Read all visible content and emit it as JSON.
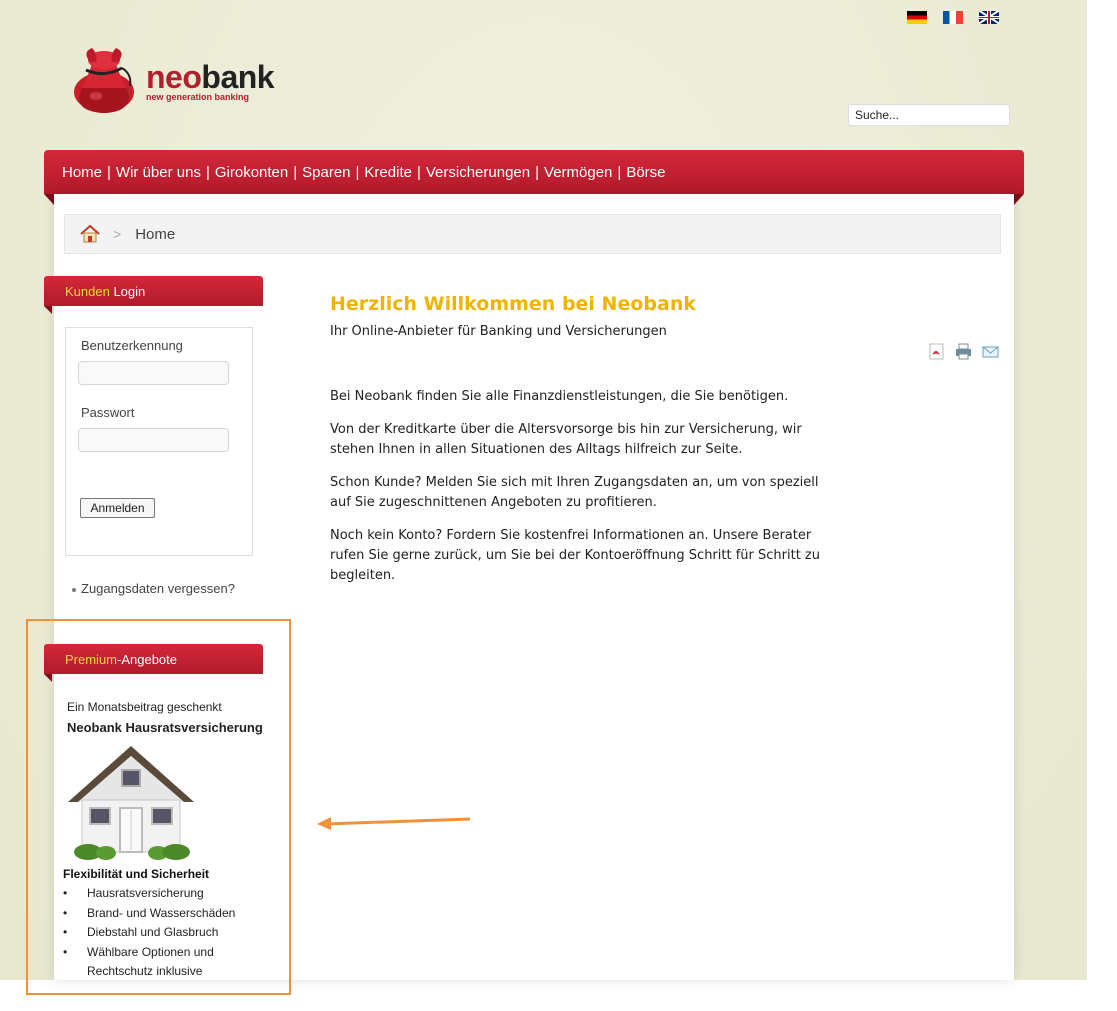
{
  "header": {
    "flags": [
      {
        "name": "german-flag-icon"
      },
      {
        "name": "french-flag-icon"
      },
      {
        "name": "english-flag-icon"
      }
    ],
    "logo": {
      "part1": "neo",
      "part2": "bank",
      "tagline": "new generation banking"
    },
    "search": {
      "value": "Suche..."
    }
  },
  "nav": {
    "items": [
      "Home",
      "Wir über uns",
      "Girokonten",
      "Sparen",
      "Kredite",
      "Versicherungen",
      "Vermögen",
      "Börse"
    ],
    "separator": "|"
  },
  "breadcrumb": {
    "separator": ">",
    "current": "Home"
  },
  "login": {
    "title_highlight": "Kunden",
    "title_rest": " Login",
    "username_label": "Benutzerkennung",
    "password_label": "Passwort",
    "submit_label": "Anmelden",
    "forgot_label": "Zugangsdaten vergessen?"
  },
  "premium": {
    "title_highlight": "Premium",
    "title_rest": "-Angebote",
    "subtitle": "Ein Monatsbeitrag geschenkt",
    "product": "Neobank Hausratsversicherung",
    "features_title": "Flexibilität und Sicherheit",
    "bullet": "•",
    "features": [
      "Hausratsversicherung",
      "Brand- und Wasserschäden",
      "Diebstahl und Glasbruch",
      "Wählbare Optionen und Rechtschutz inklusive"
    ]
  },
  "content": {
    "title": "Herzlich Willkommen bei Neobank",
    "subtitle": "Ihr Online-Anbieter für Banking und Versicherungen",
    "paragraphs": [
      "Bei Neobank finden Sie alle Finanzdienstleistungen, die Sie benötigen.",
      "Von der Kreditkarte über die Altersvorsorge bis hin zur Versicherung, wir stehen Ihnen in allen Situationen des Alltags hilfreich zur Seite.",
      "Schon Kunde? Melden Sie sich mit Ihren Zugangsdaten an, um von speziell auf Sie zugeschnittenen Angeboten zu profitieren.",
      "Noch kein Konto? Fordern Sie kostenfrei Informationen an. Unsere Berater rufen Sie gerne zurück, um Sie bei der Kontoeröffnung Schritt für Schritt zu begleiten."
    ],
    "tools": [
      "pdf-icon",
      "print-icon",
      "email-icon"
    ]
  },
  "colors": {
    "brand_red": "#b3202d",
    "title_yellow": "#f0b400",
    "highlight_orange": "#f2913a"
  }
}
